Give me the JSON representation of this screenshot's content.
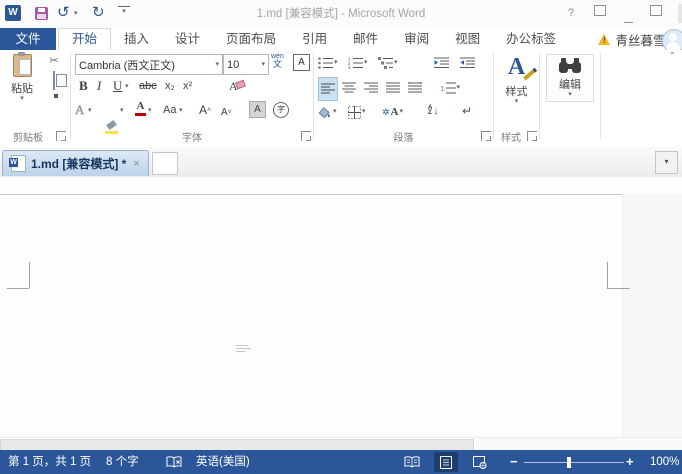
{
  "glyphs": {
    "dropdown": "▾",
    "close": "×",
    "cut": "✂",
    "undo": "↺",
    "redo": "↻",
    "help": "?",
    "chevron_up": "⌃",
    "enter_mark": "↵",
    "warning": "!",
    "minus": "−",
    "plus": "+",
    "updown": "↕",
    "caret_up": "˄",
    "caret_down": "˅",
    "asterisk": "✲",
    "sort_arrow": "↓",
    "indent_left": "◂",
    "indent_right": "▸"
  },
  "titlebar": {
    "title": "1.md [兼容模式] - Microsoft Word"
  },
  "tabs": {
    "file": "文件",
    "items": [
      "开始",
      "插入",
      "设计",
      "页面布局",
      "引用",
      "邮件",
      "审阅",
      "视图",
      "办公标签"
    ],
    "account": "青丝暮雪"
  },
  "ribbon": {
    "clipboard": {
      "paste": "粘贴",
      "label": "剪贴板"
    },
    "font": {
      "label": "字体",
      "name": "Cambria (西文正文)",
      "size": "10",
      "bold": "B",
      "italic": "I",
      "underline": "U",
      "strike": "abc",
      "subscript": "x₂",
      "superscript": "x²",
      "phonetic": "wén",
      "phonetic_char": "文",
      "border_a": "A",
      "clear_a": "A",
      "effects_a": "A",
      "color_a": "A",
      "case_aa": "Aa",
      "grow_a": "A",
      "shrink_a": "A",
      "shading_a": "A",
      "enclose": "字"
    },
    "paragraph": {
      "label": "段落",
      "sort_a": "A",
      "sort_z": "Z",
      "asian_a": "A"
    },
    "styles": {
      "big_a": "A",
      "button": "样式",
      "label": "样式"
    },
    "editing": {
      "button": "编辑"
    }
  },
  "doctab": {
    "title": "1.md [兼容模式] *"
  },
  "status": {
    "page": "第 1 页，共 1 页",
    "words": "8 个字",
    "language": "英语(美国)",
    "zoom": "100%"
  },
  "colors": {
    "accent": "#2b579a",
    "highlight": "#ffe14d",
    "font_color": "#c00000"
  }
}
